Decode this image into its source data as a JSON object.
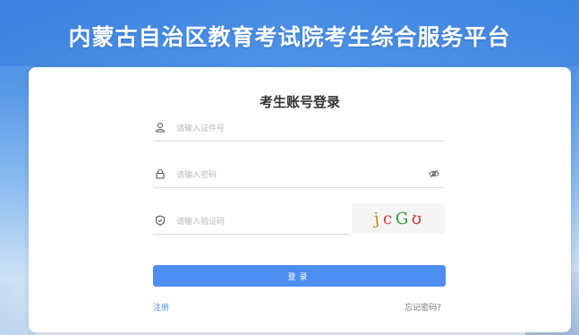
{
  "header": {
    "title": "内蒙古自治区教育考试院考生综合服务平台"
  },
  "login": {
    "title": "考生账号登录",
    "id_placeholder": "请输入证件号",
    "password_placeholder": "请输入密码",
    "captcha_placeholder": "请输入验证码",
    "captcha_chars": [
      "j",
      "c",
      "G",
      "ʊ"
    ],
    "captcha_colors": [
      "#b58a1a",
      "#d8323c",
      "#2f9e3a",
      "#c0392b"
    ],
    "submit_label": "登录",
    "register_link": "注册",
    "forgot_link": "忘记密码?"
  },
  "theme": {
    "accent": "#4c8ef1"
  }
}
